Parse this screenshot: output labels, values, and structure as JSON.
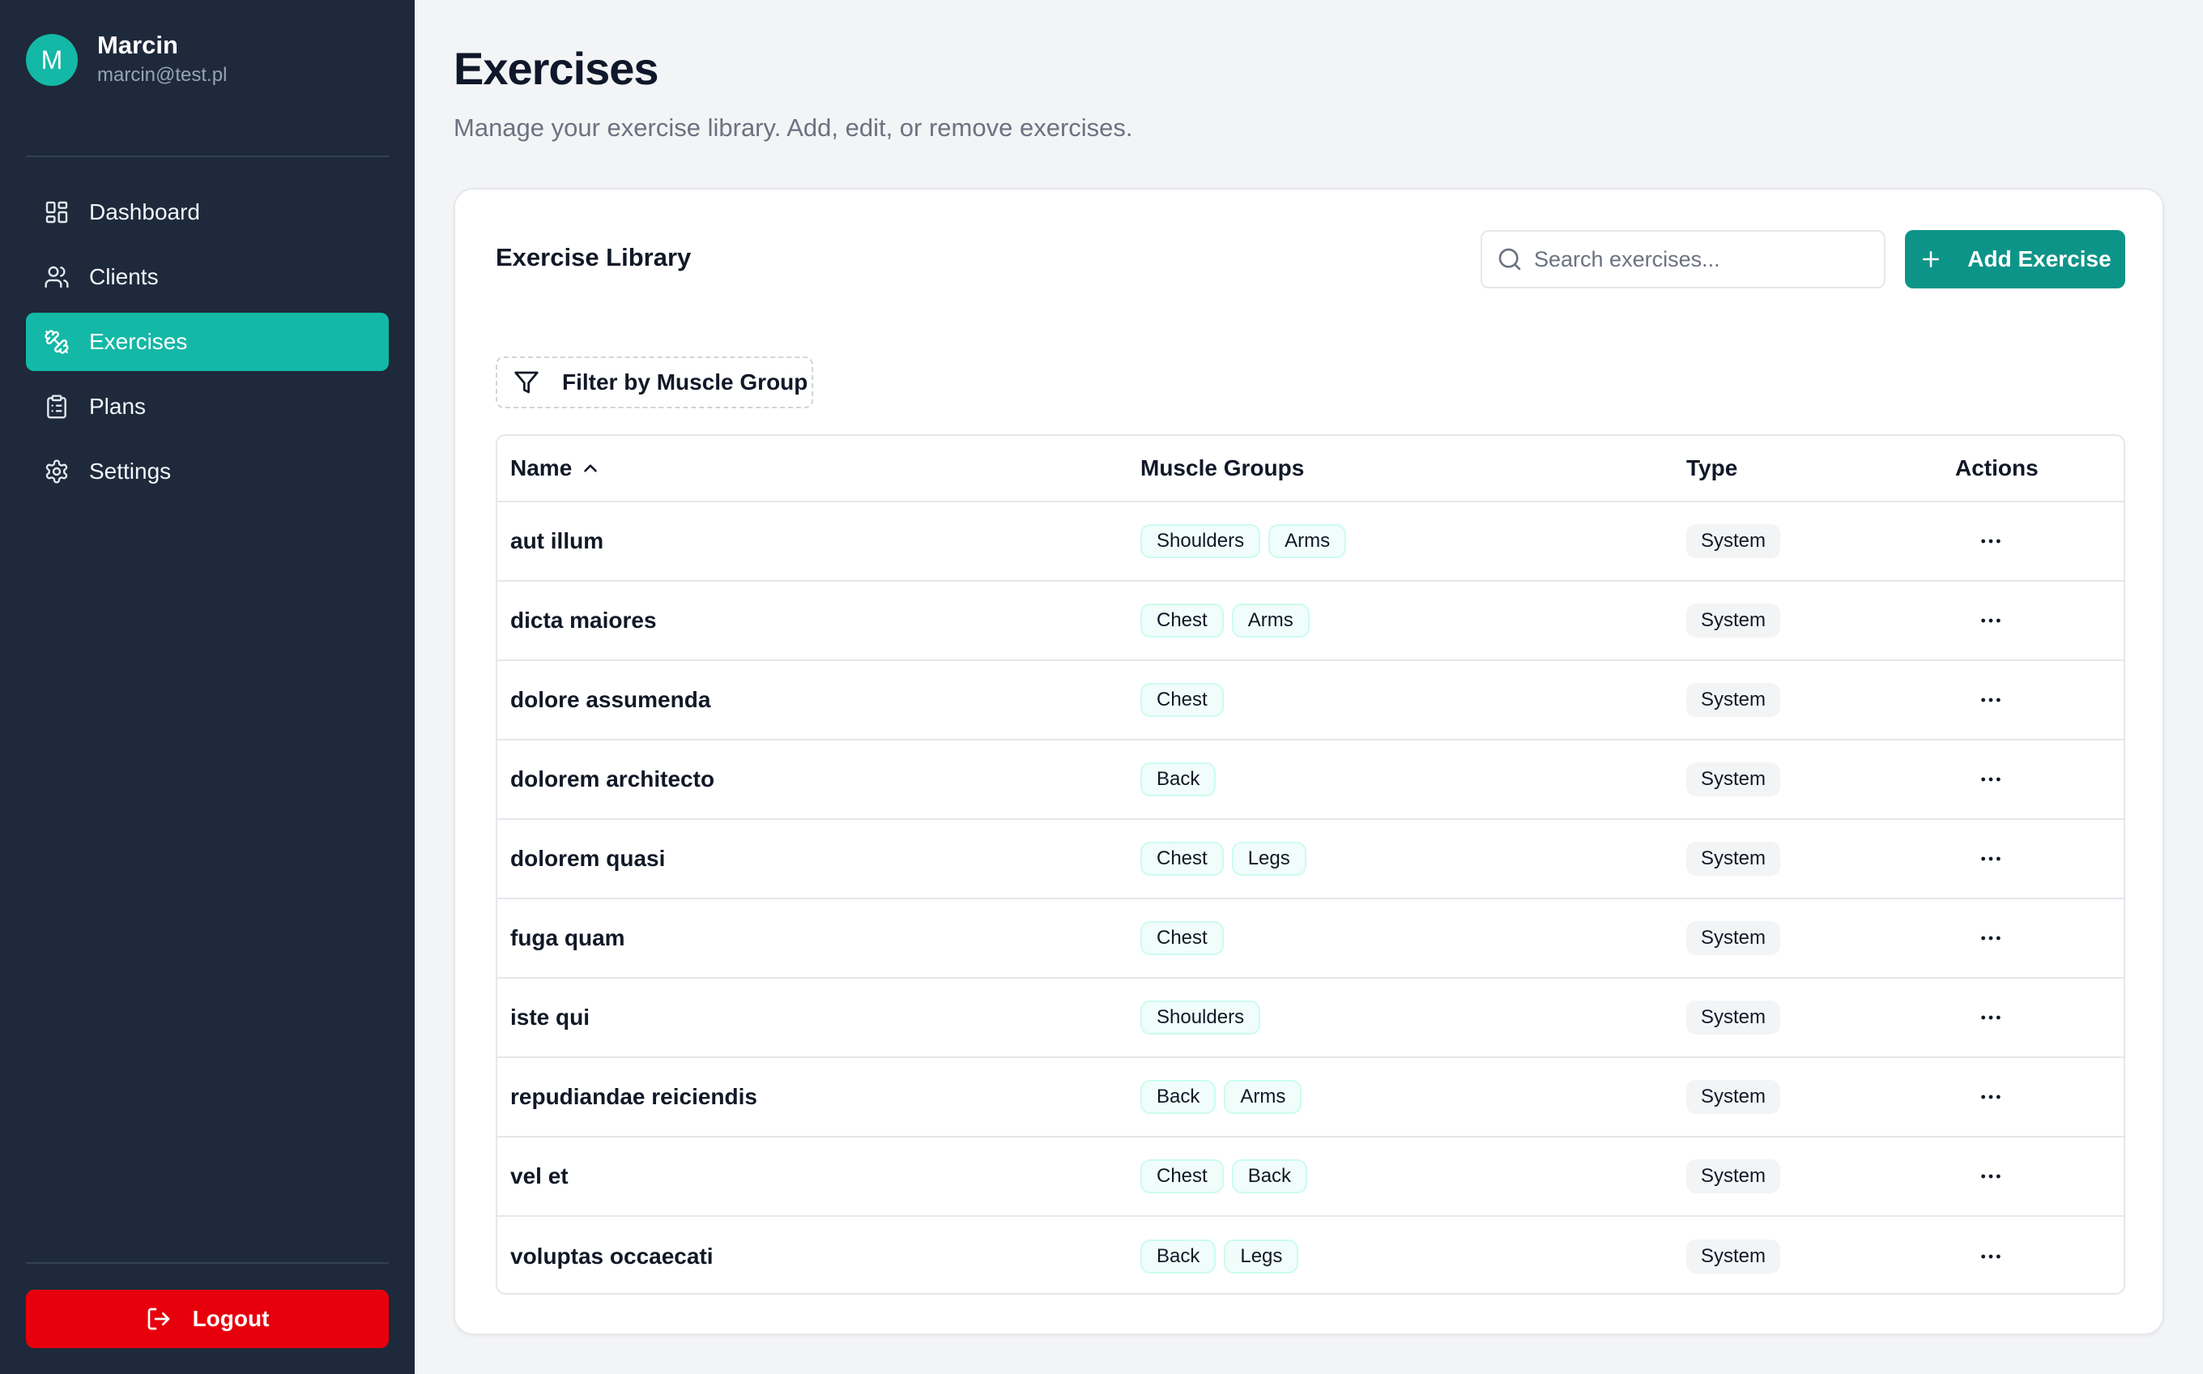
{
  "user": {
    "initial": "M",
    "name": "Marcin",
    "email": "marcin@test.pl"
  },
  "nav": {
    "items": [
      {
        "label": "Dashboard",
        "icon": "dashboard-icon"
      },
      {
        "label": "Clients",
        "icon": "users-icon"
      },
      {
        "label": "Exercises",
        "icon": "dumbbell-icon",
        "active": true
      },
      {
        "label": "Plans",
        "icon": "clipboard-icon"
      },
      {
        "label": "Settings",
        "icon": "gear-icon"
      }
    ],
    "logout_label": "Logout"
  },
  "page": {
    "title": "Exercises",
    "subtitle": "Manage your exercise library. Add, edit, or remove exercises."
  },
  "library": {
    "title": "Exercise Library",
    "search_placeholder": "Search exercises...",
    "add_label": "Add Exercise",
    "filter_label": "Filter by Muscle Group"
  },
  "table": {
    "headers": {
      "name": "Name",
      "muscle_groups": "Muscle Groups",
      "type": "Type",
      "actions": "Actions"
    },
    "rows": [
      {
        "name": "aut illum",
        "muscles": [
          "Shoulders",
          "Arms"
        ],
        "type": "System"
      },
      {
        "name": "dicta maiores",
        "muscles": [
          "Chest",
          "Arms"
        ],
        "type": "System"
      },
      {
        "name": "dolore assumenda",
        "muscles": [
          "Chest"
        ],
        "type": "System"
      },
      {
        "name": "dolorem architecto",
        "muscles": [
          "Back"
        ],
        "type": "System"
      },
      {
        "name": "dolorem quasi",
        "muscles": [
          "Chest",
          "Legs"
        ],
        "type": "System"
      },
      {
        "name": "fuga quam",
        "muscles": [
          "Chest"
        ],
        "type": "System"
      },
      {
        "name": "iste qui",
        "muscles": [
          "Shoulders"
        ],
        "type": "System"
      },
      {
        "name": "repudiandae reiciendis",
        "muscles": [
          "Back",
          "Arms"
        ],
        "type": "System"
      },
      {
        "name": "vel et",
        "muscles": [
          "Chest",
          "Back"
        ],
        "type": "System"
      },
      {
        "name": "voluptas occaecati",
        "muscles": [
          "Back",
          "Legs"
        ],
        "type": "System"
      }
    ]
  },
  "colors": {
    "sidebar_bg": "#1e293b",
    "accent": "#14b8a6",
    "primary_button": "#0d9488",
    "logout": "#e7000b"
  }
}
